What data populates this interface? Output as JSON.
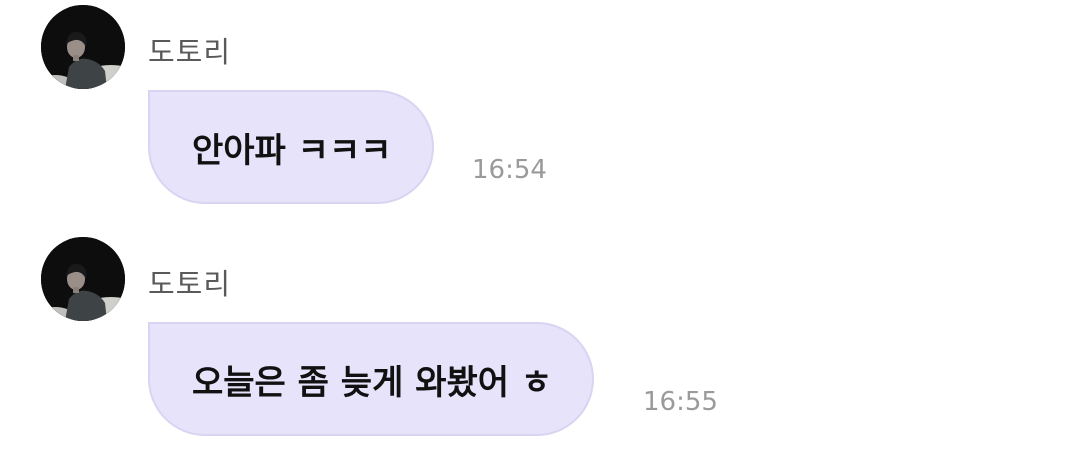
{
  "messages": [
    {
      "sender": "도토리",
      "text": "안아파 ㅋㅋㅋ",
      "time": "16:54",
      "avatar_icon": "profile-photo"
    },
    {
      "sender": "도토리",
      "text": "오늘은 좀 늦게 와봤어 ㅎ",
      "time": "16:55",
      "avatar_icon": "profile-photo"
    }
  ],
  "colors": {
    "bubble_background": "#e6e3fa",
    "bubble_border": "#d8d4f2",
    "sender_text": "#5a5a5a",
    "time_text": "#9a9a9a",
    "message_text": "#111111"
  }
}
